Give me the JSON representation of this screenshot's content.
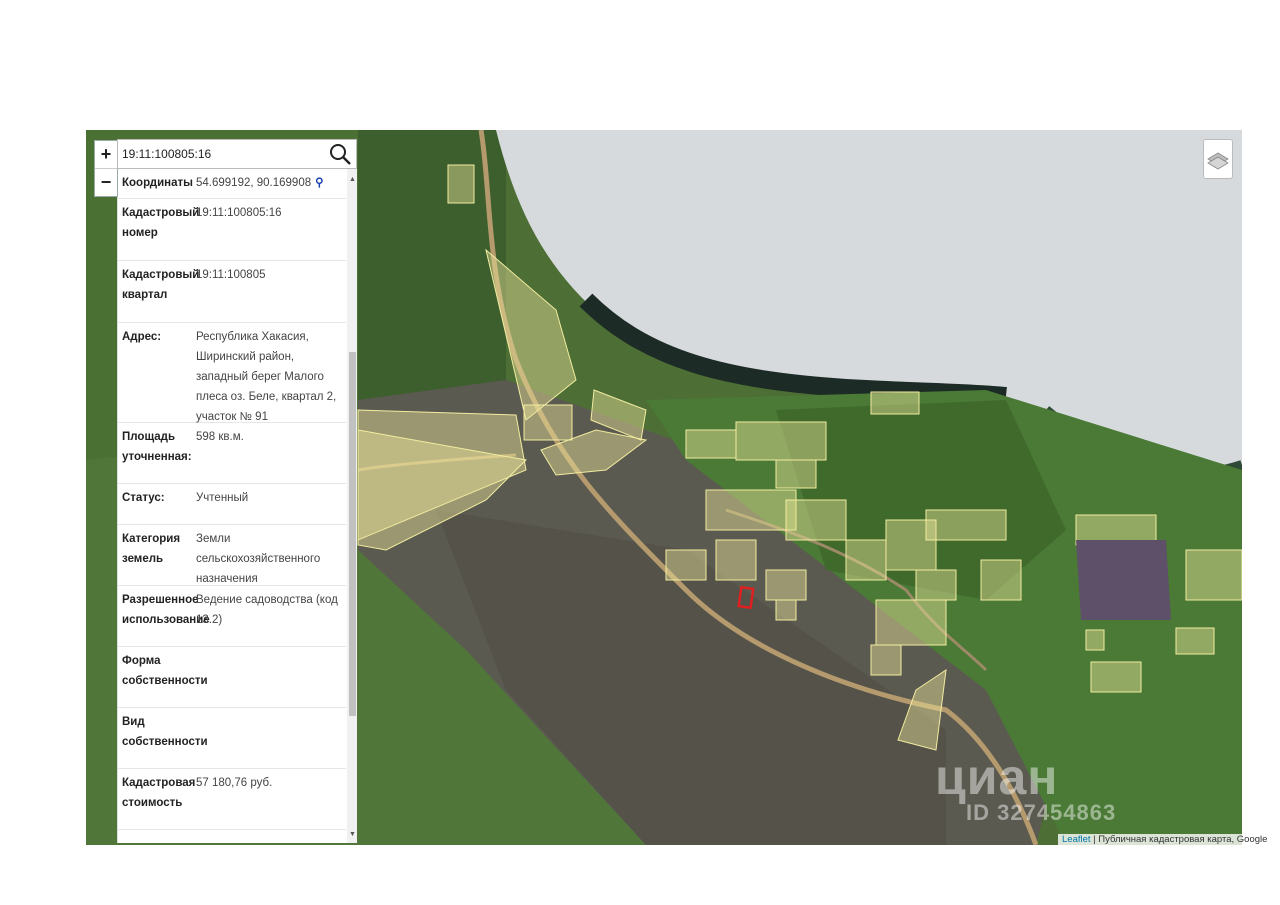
{
  "search": {
    "value": "19:11:100805:16"
  },
  "zoom": {
    "in_label": "+",
    "out_label": "−"
  },
  "info_rows": [
    {
      "label": "Координаты",
      "value": "54.699192, 90.169908"
    },
    {
      "label": "Кадастровый номер",
      "value": "19:11:100805:16"
    },
    {
      "label": "Кадастровый квартал",
      "value": "19:11:100805"
    },
    {
      "label": "Адрес:",
      "value": "Республика Хакасия, Ширинский район, западный берег Малого плеса оз. Беле, квартал 2, участок № 91"
    },
    {
      "label": "Площадь уточненная:",
      "value": "598 кв.м."
    },
    {
      "label": "Статус:",
      "value": "Учтенный"
    },
    {
      "label": "Категория земель",
      "value": "Земли сельскохозяйственного назначения"
    },
    {
      "label": "Разрешенное использование",
      "value": "Ведение садоводства (код 13.2)"
    },
    {
      "label": "Форма собственности",
      "value": ""
    },
    {
      "label": "Вид собственности",
      "value": ""
    },
    {
      "label": "Кадастровая стоимость",
      "value": "57 180,76 руб."
    }
  ],
  "icons": {
    "search": "search-icon",
    "layers": "layers-icon",
    "coord_link": "map-link-icon"
  },
  "colors": {
    "parcel_fill": "#e8e29a",
    "selected_parcel": "#e02020",
    "lake": "#d9dde0"
  },
  "watermark": {
    "brand": "циан",
    "id": "ID 327454863"
  },
  "attribution": {
    "leaflet": "Leaflet",
    "rest": " | Публичная кадастровая карта, Google"
  }
}
